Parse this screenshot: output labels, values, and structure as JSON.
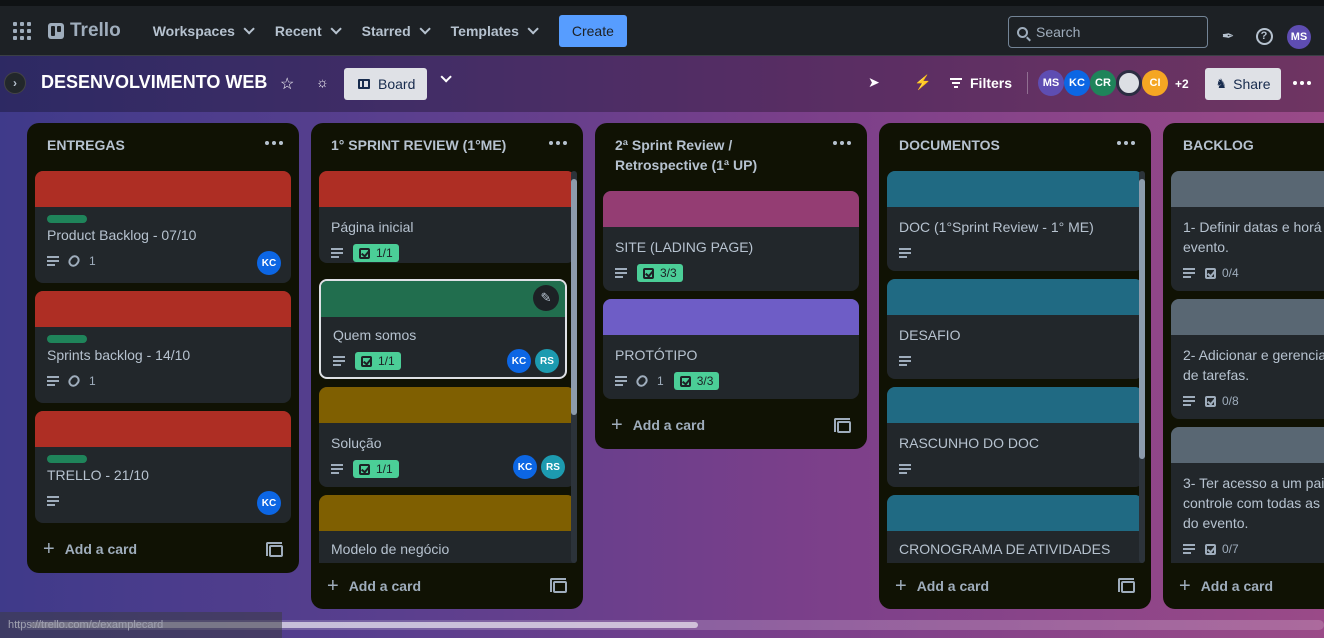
{
  "topnav": {
    "brand": "Trello",
    "menu": [
      "Workspaces",
      "Recent",
      "Starred",
      "Templates"
    ],
    "create_label": "Create",
    "search_placeholder": "Search",
    "user_initials": "MS"
  },
  "board": {
    "name": "DESENVOLVIMENTO WEB",
    "view_label": "Board",
    "filters_label": "Filters",
    "share_label": "Share",
    "members": [
      {
        "initials": "MS",
        "color": "#5e4db2"
      },
      {
        "initials": "KC",
        "color": "#0c66e4"
      },
      {
        "initials": "CR",
        "color": "#1f845a"
      },
      {
        "initials": "",
        "color": "#dcdfe4"
      },
      {
        "initials": "CI",
        "color": "#f5a623"
      }
    ],
    "members_more": "+2"
  },
  "lists": [
    {
      "title": "ENTREGAS",
      "add_label": "Add a card",
      "cards": [
        {
          "title": "Product Backlog - 07/10",
          "attachments": "1",
          "member": "KC"
        },
        {
          "title": "Sprints backlog - 14/10",
          "attachments": "1"
        },
        {
          "title": "TRELLO - 21/10",
          "member": "KC"
        }
      ]
    },
    {
      "title": "1° SPRINT REVIEW (1°ME)",
      "add_label": "Add a card",
      "cards": [
        {
          "title": "Página inicial",
          "checklist": "1/1"
        },
        {
          "title": "Quem somos",
          "checklist": "1/1",
          "members": [
            "KC",
            "RS"
          ]
        },
        {
          "title": "Solução",
          "checklist": "1/1",
          "members": [
            "KC",
            "RS"
          ]
        },
        {
          "title": "Modelo de negócio"
        }
      ]
    },
    {
      "title": "2ª Sprint Review / Retrospective (1ª UP)",
      "add_label": "Add a card",
      "cards": [
        {
          "title": "SITE (LADING PAGE)",
          "checklist": "3/3"
        },
        {
          "title": "PROTÓTIPO",
          "attachments": "1",
          "checklist": "3/3"
        }
      ]
    },
    {
      "title": "DOCUMENTOS",
      "add_label": "Add a card",
      "cards": [
        {
          "title": "DOC (1°Sprint Review - 1° ME)"
        },
        {
          "title": "DESAFIO"
        },
        {
          "title": "RASCUNHO DO DOC"
        },
        {
          "title": "CRONOGRAMA DE ATIVIDADES"
        }
      ]
    },
    {
      "title": "BACKLOG",
      "add_label": "Add a card",
      "cards": [
        {
          "title": "1- Definir datas e horá",
          "title_2": "evento.",
          "checklist": "0/4"
        },
        {
          "title": "2- Adicionar e gerencia",
          "title_2": "de tarefas.",
          "checklist": "0/8"
        },
        {
          "title": "3- Ter acesso a um pai",
          "title_2": "controle com todas as",
          "title_3": "do evento.",
          "checklist": "0/7"
        }
      ]
    }
  ],
  "status_url": "https://trello.com/c/examplecard"
}
